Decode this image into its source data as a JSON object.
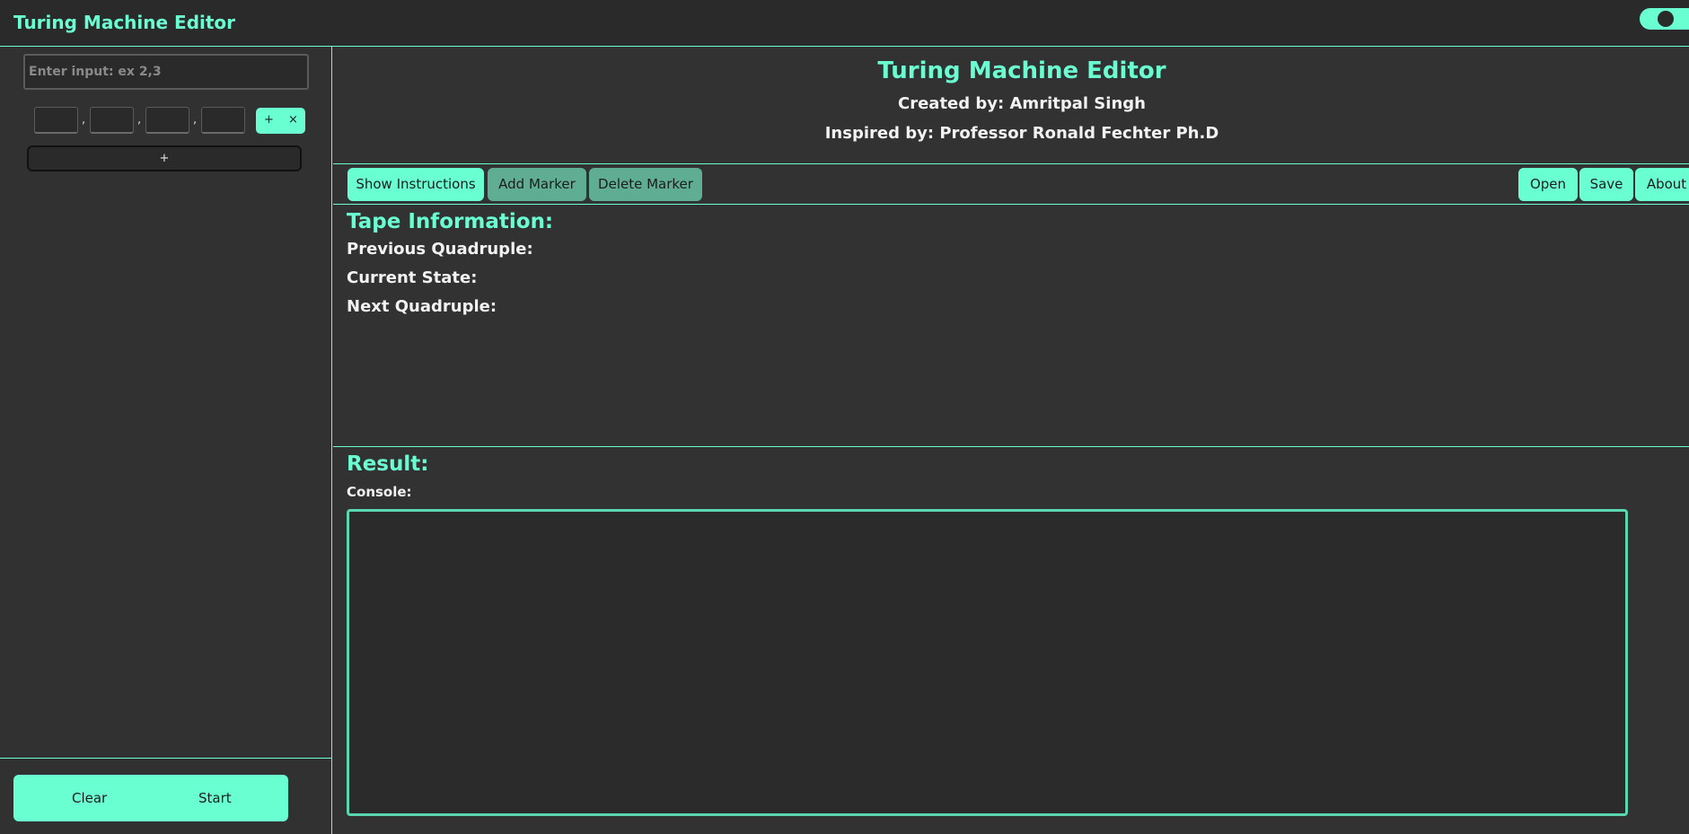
{
  "app": {
    "title": "Turing Machine Editor"
  },
  "theme_toggle": {
    "state": "on"
  },
  "sidebar": {
    "input": {
      "placeholder": "Enter input: ex 2,3",
      "value": ""
    },
    "quadruple_row": {
      "fields": [
        "",
        "",
        "",
        ""
      ],
      "separator": ",",
      "add_label": "+",
      "remove_label": "×"
    },
    "add_row_label": "+",
    "clear_label": "Clear",
    "start_label": "Start"
  },
  "header": {
    "title": "Turing Machine Editor",
    "created_by": "Created by: Amritpal Singh",
    "inspired_by": "Inspired by: Professor Ronald Fechter Ph.D"
  },
  "toolbar": {
    "show_instructions": "Show Instructions",
    "add_marker": "Add Marker",
    "delete_marker": "Delete Marker",
    "open": "Open",
    "save": "Save",
    "about": "About"
  },
  "tape_info": {
    "heading": "Tape Information:",
    "previous_quadruple": "Previous Quadruple:",
    "current_state": "Current State:",
    "next_quadruple": "Next Quadruple:"
  },
  "result": {
    "heading": "Result:",
    "console_label": "Console:",
    "console_text": ""
  },
  "colors": {
    "accent": "#6affd1",
    "accent_dim": "#5fae93",
    "background": "#2f2f2f",
    "text": "#f2f2f2"
  }
}
